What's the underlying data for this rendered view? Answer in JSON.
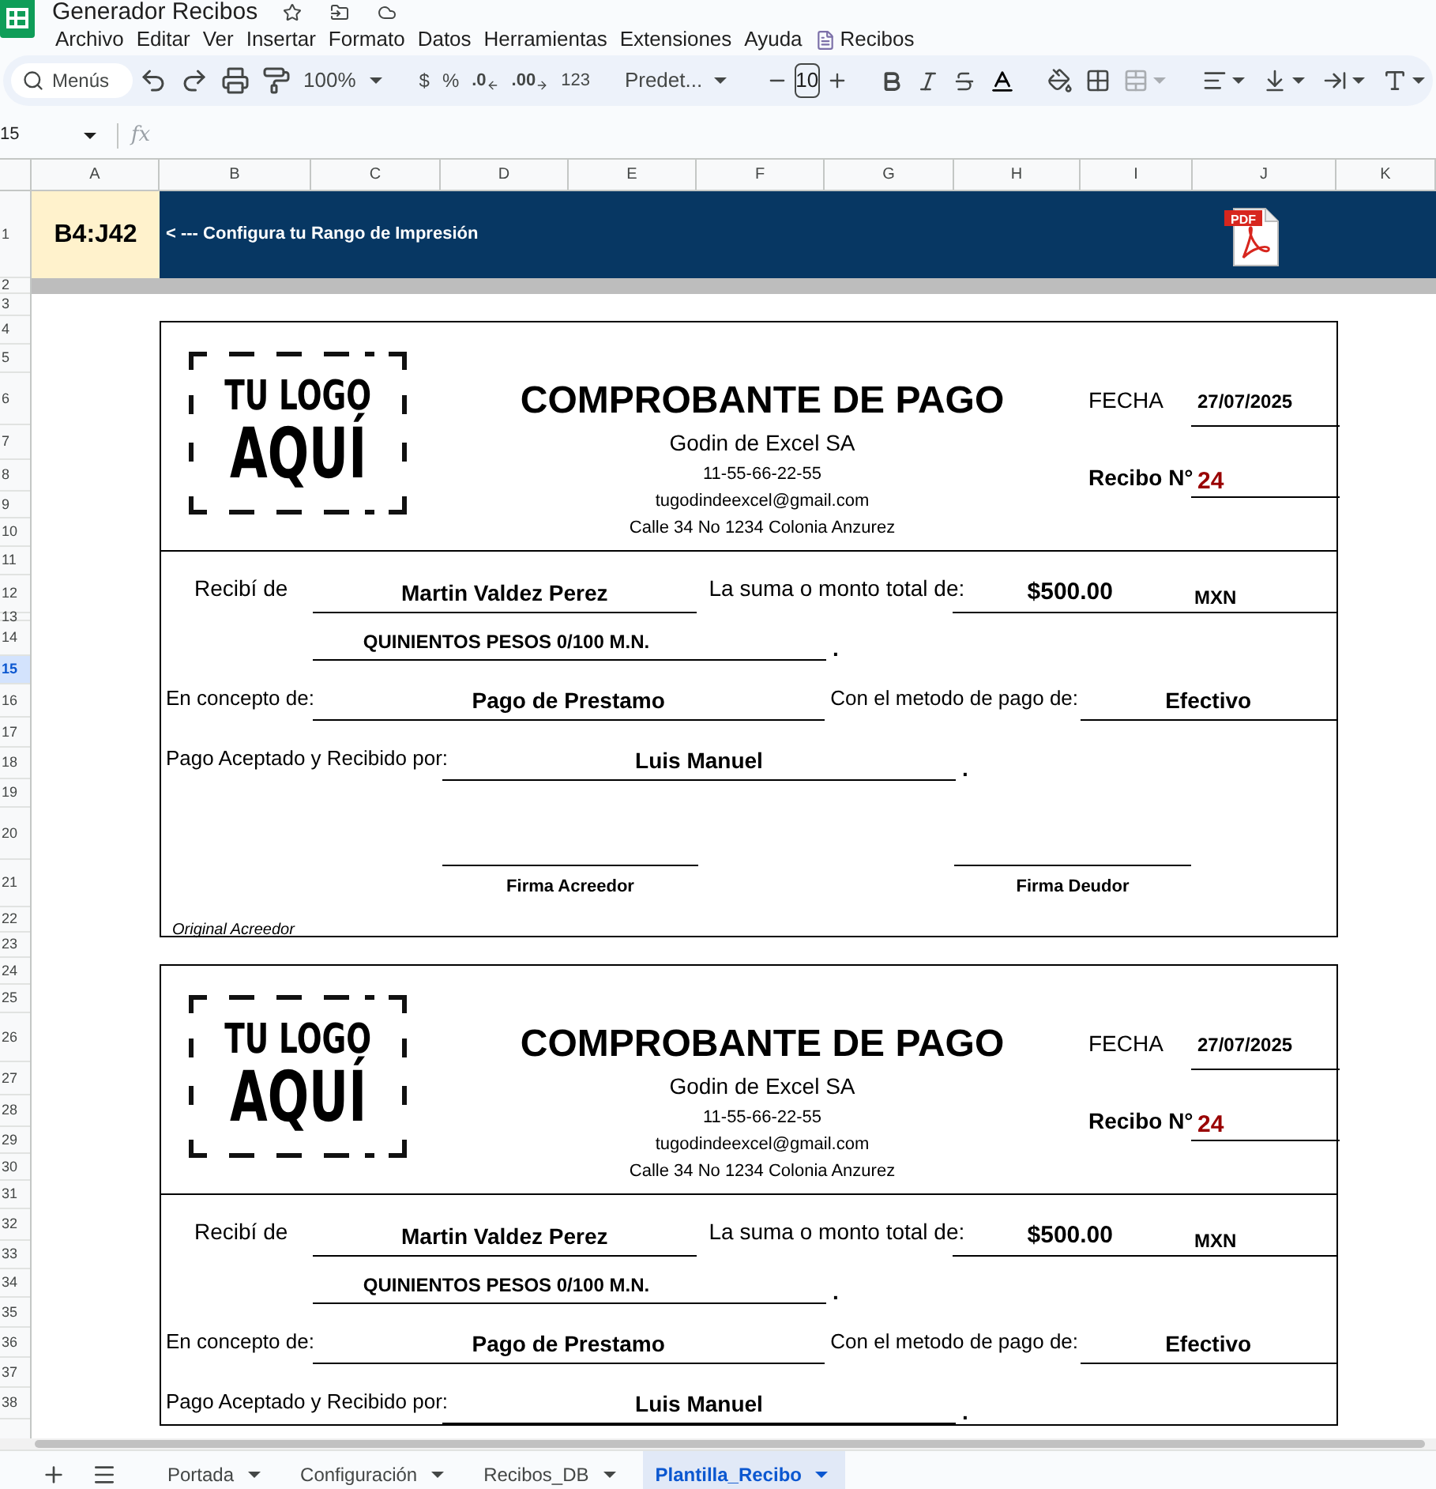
{
  "app": {
    "title": "Generador Recibos",
    "menu": [
      {
        "label": "Archivo",
        "kind": "menu"
      },
      {
        "label": "Editar",
        "kind": "menu"
      },
      {
        "label": "Ver",
        "kind": "menu"
      },
      {
        "label": "Insertar",
        "kind": "menu"
      },
      {
        "label": "Formato",
        "kind": "menu"
      },
      {
        "label": "Datos",
        "kind": "menu"
      },
      {
        "label": "Herramientas",
        "kind": "menu"
      },
      {
        "label": "Extensiones",
        "kind": "menu"
      },
      {
        "label": "Ayuda",
        "kind": "menu"
      },
      {
        "label": "Recibos",
        "kind": "addon"
      }
    ]
  },
  "toolbar": {
    "search_placeholder": "Menús",
    "zoom": "100%",
    "currency": "$",
    "percent": "%",
    "decrease_decimals": ".0",
    "increase_decimals": ".00",
    "number_format": "123",
    "font": "Predet...",
    "font_size": "10"
  },
  "formula_bar": {
    "name_box": "15",
    "fx": "fx"
  },
  "columns": [
    "A",
    "B",
    "C",
    "D",
    "E",
    "F",
    "G",
    "H",
    "I",
    "J",
    "K"
  ],
  "rows": [
    {
      "label": "1",
      "selected": false
    },
    {
      "label": "2",
      "selected": false
    },
    {
      "label": "3",
      "selected": false
    },
    {
      "label": "4",
      "selected": false
    },
    {
      "label": "5",
      "selected": false
    },
    {
      "label": "6",
      "selected": false
    },
    {
      "label": "7",
      "selected": false
    },
    {
      "label": "8",
      "selected": false
    },
    {
      "label": "9",
      "selected": false
    },
    {
      "label": "10",
      "selected": false
    },
    {
      "label": "11",
      "selected": false
    },
    {
      "label": "12",
      "selected": false
    },
    {
      "label": "13",
      "selected": false
    },
    {
      "label": "14",
      "selected": false
    },
    {
      "label": "15",
      "selected": true
    },
    {
      "label": "16",
      "selected": false
    },
    {
      "label": "17",
      "selected": false
    },
    {
      "label": "18",
      "selected": false
    },
    {
      "label": "19",
      "selected": false
    },
    {
      "label": "20",
      "selected": false
    },
    {
      "label": "21",
      "selected": false
    },
    {
      "label": "22",
      "selected": false
    },
    {
      "label": "23",
      "selected": false
    },
    {
      "label": "24",
      "selected": false
    },
    {
      "label": "25",
      "selected": false
    },
    {
      "label": "26",
      "selected": false
    },
    {
      "label": "27",
      "selected": false
    },
    {
      "label": "28",
      "selected": false
    },
    {
      "label": "29",
      "selected": false
    },
    {
      "label": "30",
      "selected": false
    },
    {
      "label": "31",
      "selected": false
    },
    {
      "label": "32",
      "selected": false
    },
    {
      "label": "33",
      "selected": false
    },
    {
      "label": "34",
      "selected": false
    },
    {
      "label": "35",
      "selected": false
    },
    {
      "label": "36",
      "selected": false
    },
    {
      "label": "37",
      "selected": false
    },
    {
      "label": "38",
      "selected": false
    }
  ],
  "banner": {
    "range": "B4:J42",
    "text": "< --- Configura tu Rango de Impresión",
    "pdf_label": "PDF"
  },
  "receipts": [
    {
      "logo_top": "TU LOGO",
      "logo_bottom": "AQUÍ",
      "title": "COMPROBANTE DE PAGO",
      "company": "Godin de Excel SA",
      "phone": "11-55-66-22-55",
      "email": "tugodindeexcel@gmail.com",
      "address": "Calle 34 No 1234 Colonia Anzurez",
      "date_label": "FECHA",
      "date": "27/07/2025",
      "number_label": "Recibo N°",
      "number": "24",
      "from_label": "Recibí de",
      "from": "Martin Valdez Perez",
      "amount_label": "La suma o monto total de:",
      "amount": "$500.00",
      "currency": "MXN",
      "amount_words": "QUINIENTOS PESOS 0/100 M.N.",
      "amount_words_end": ".",
      "concept_label": "En concepto de:",
      "concept": "Pago de Prestamo",
      "method_label": "Con el metodo de pago de:",
      "method": "Efectivo",
      "accepted_label": "Pago Aceptado y Recibido por:",
      "accepted_by": "Luis Manuel",
      "accepted_end": ".",
      "sign_left": "Firma Acreedor",
      "sign_right": "Firma Deudor",
      "note": "Original Acreedor"
    },
    {
      "logo_top": "TU LOGO",
      "logo_bottom": "AQUÍ",
      "title": "COMPROBANTE DE PAGO",
      "company": "Godin de Excel SA",
      "phone": "11-55-66-22-55",
      "email": "tugodindeexcel@gmail.com",
      "address": "Calle 34 No 1234 Colonia Anzurez",
      "date_label": "FECHA",
      "date": "27/07/2025",
      "number_label": "Recibo N°",
      "number": "24",
      "from_label": "Recibí de",
      "from": "Martin Valdez Perez",
      "amount_label": "La suma o monto total de:",
      "amount": "$500.00",
      "currency": "MXN",
      "amount_words": "QUINIENTOS PESOS 0/100 M.N.",
      "amount_words_end": ".",
      "concept_label": "En concepto de:",
      "concept": "Pago de Prestamo",
      "method_label": "Con el metodo de pago de:",
      "method": "Efectivo",
      "accepted_label": "Pago Aceptado y Recibido por:",
      "accepted_by": "Luis Manuel",
      "accepted_end": "."
    }
  ],
  "sheet_tabs": [
    {
      "label": "Portada",
      "selected": false
    },
    {
      "label": "Configuración",
      "selected": false
    },
    {
      "label": "Recibos_DB",
      "selected": false
    },
    {
      "label": "Plantilla_Recibo",
      "selected": true
    }
  ]
}
